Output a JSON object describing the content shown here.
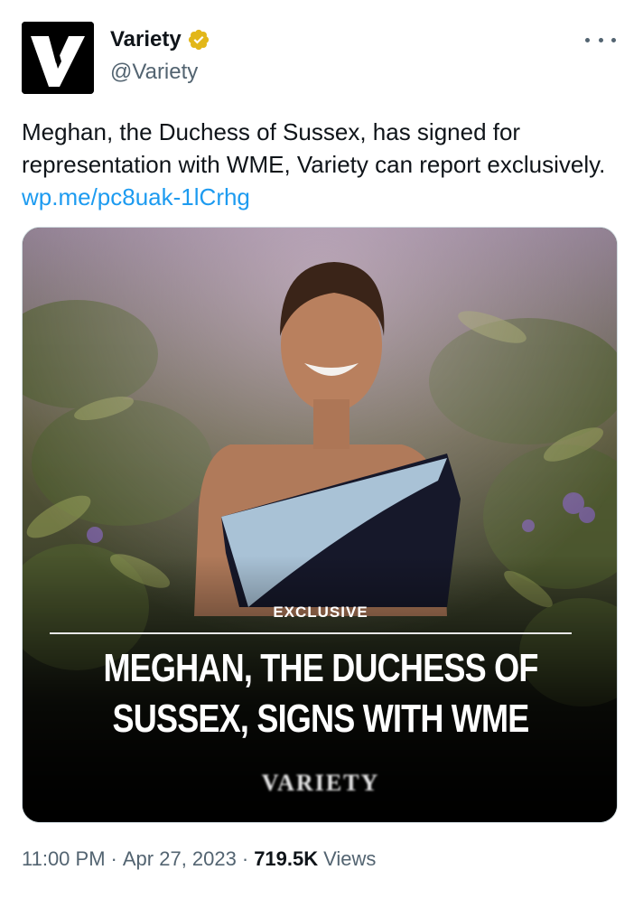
{
  "author": {
    "display_name": "Variety",
    "handle": "@Variety",
    "avatar_logo": "V",
    "verified": true,
    "verified_color": "#e2b719"
  },
  "tweet": {
    "text": "Meghan, the Duchess of Sussex, has signed for representation with WME, Variety can report exclusively. ",
    "link_text": "wp.me/pc8uak-1lCrhg",
    "link_color": "#1d9bf0"
  },
  "media": {
    "tag": "EXCLUSIVE",
    "headline_line1": "MEGHAN, THE DUCHESS OF",
    "headline_line2": "SUSSEX, SIGNS WITH WME",
    "logo": "VARIETY"
  },
  "meta": {
    "time": "11:00 PM",
    "sep1": "·",
    "date": "Apr 27, 2023",
    "sep2": "·",
    "views_count": "719.5K",
    "views_label": "Views"
  },
  "icons": {
    "more": "more-horizontal-icon",
    "verified": "verified-badge-icon"
  }
}
